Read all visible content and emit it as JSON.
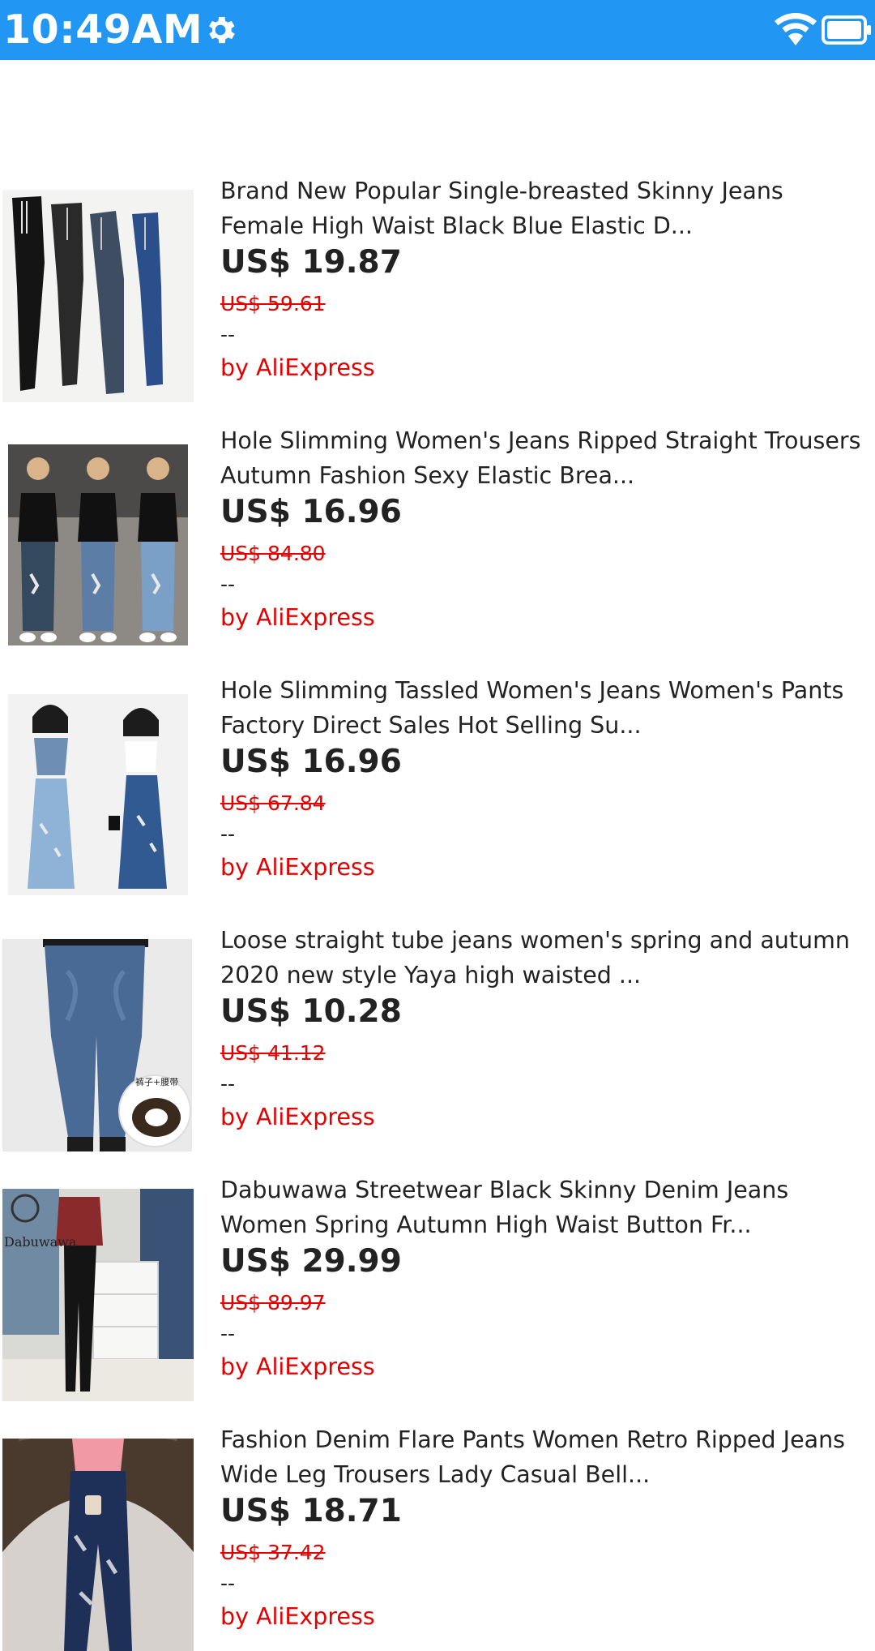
{
  "status_bar": {
    "time": "10:49AM",
    "color": "#2196f3",
    "icons": [
      "gear-icon",
      "wifi-icon",
      "battery-icon"
    ]
  },
  "products": [
    {
      "title_line1": "Brand New Popular Single-breasted Skinny Jeans",
      "title_line2": "Female High Waist Black Blue Elastic D...",
      "price": "US$ 19.87",
      "original_price": "US$ 59.61",
      "rating": "--",
      "seller": "by AliExpress"
    },
    {
      "title_line1": "Hole Slimming Women's Jeans Ripped Straight Trousers",
      "title_line2": "Autumn Fashion Sexy Elastic Brea...",
      "price": "US$ 16.96",
      "original_price": "US$ 84.80",
      "rating": "--",
      "seller": "by AliExpress"
    },
    {
      "title_line1": "Hole Slimming Tassled Women's Jeans Women's Pants",
      "title_line2": "Factory Direct Sales Hot Selling Su...",
      "price": "US$ 16.96",
      "original_price": "US$ 67.84",
      "rating": "--",
      "seller": "by AliExpress"
    },
    {
      "title_line1": "Loose straight tube jeans women's spring and autumn",
      "title_line2": "2020 new style Yaya high waisted ...",
      "price": "US$ 10.28",
      "original_price": "US$ 41.12",
      "rating": "--",
      "seller": "by AliExpress",
      "image_caption": "裤子+腰带"
    },
    {
      "title_line1": "Dabuwawa Streetwear Black Skinny Denim Jeans",
      "title_line2": "Women Spring Autumn High Waist Button Fr...",
      "price": "US$ 29.99",
      "original_price": "US$ 89.97",
      "rating": "--",
      "seller": "by AliExpress",
      "image_logo": "Dabuwawa"
    },
    {
      "title_line1": "Fashion Denim Flare Pants Women Retro Ripped Jeans",
      "title_line2": "Wide Leg Trousers Lady Casual Bell...",
      "price": "US$ 18.71",
      "original_price": "US$ 37.42",
      "rating": "--",
      "seller": "by AliExpress"
    }
  ],
  "colors": {
    "accent": "#2196f3",
    "price_original": "#e60000",
    "seller": "#e60000",
    "text": "#222222"
  }
}
